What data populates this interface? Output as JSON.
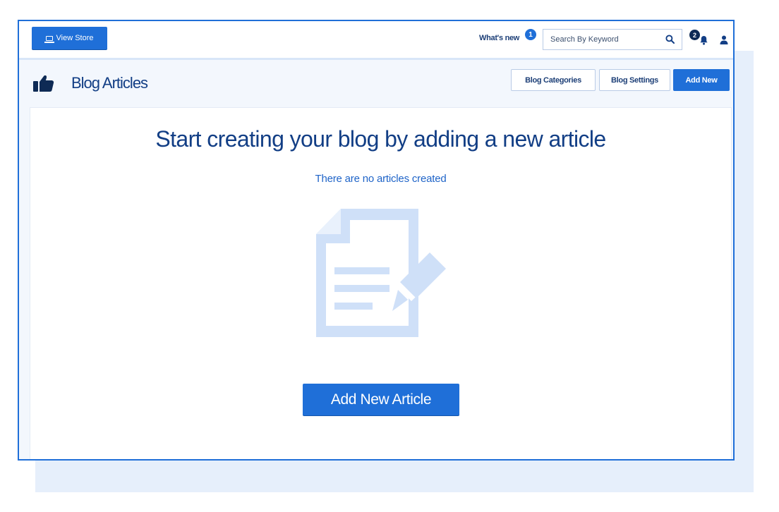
{
  "topbar": {
    "view_store_label": "View Store",
    "whats_new_label": "What's new",
    "whats_new_count": "1",
    "search_placeholder": "Search By Keyword",
    "notification_count": "2"
  },
  "header": {
    "title": "Blog Articles",
    "buttons": {
      "blog_categories": "Blog Categories",
      "blog_settings": "Blog Settings",
      "add_new": "Add New"
    }
  },
  "empty_state": {
    "heading": "Start creating your blog by adding a new article",
    "subtext": "There are no articles created",
    "cta_label": "Add New Article"
  },
  "icons": {
    "view_store": "monitor-icon",
    "search": "search-icon",
    "notifications": "bell-icon",
    "account": "user-icon",
    "page": "thumbs-up-icon",
    "illustration": "document-edit-icon"
  },
  "colors": {
    "accent": "#1f6fd8",
    "heading": "#123e85",
    "illustration": "#cfe0f8"
  }
}
